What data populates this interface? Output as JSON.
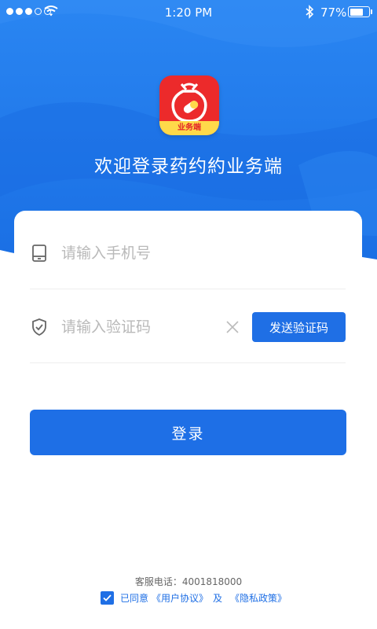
{
  "status_bar": {
    "time": "1:20 PM",
    "battery_percent_text": "77%",
    "battery_level": 0.77,
    "signal_bars_filled": 3,
    "signal_bars_total": 5
  },
  "logo": {
    "badge_text": "业务端"
  },
  "welcome_title": "欢迎登录药约約业务端",
  "form": {
    "phone_placeholder": "请输入手机号",
    "code_placeholder": "请输入验证码",
    "send_code_label": "发送验证码",
    "login_label": "登录"
  },
  "footer": {
    "hotline": "客服电话：4001818000",
    "agree_prefix": "已同意",
    "user_agreement": "《用户协议》",
    "and": "及",
    "privacy_policy": "《隐私政策》",
    "agreed": true
  },
  "colors": {
    "primary": "#1f6fe5",
    "logo_red": "#ec2a2b",
    "logo_yellow": "#ffd94a"
  },
  "icons": [
    "wifi-icon",
    "bluetooth-icon",
    "battery-icon",
    "phone-device-icon",
    "shield-icon",
    "clear-icon",
    "checkmark-icon"
  ]
}
